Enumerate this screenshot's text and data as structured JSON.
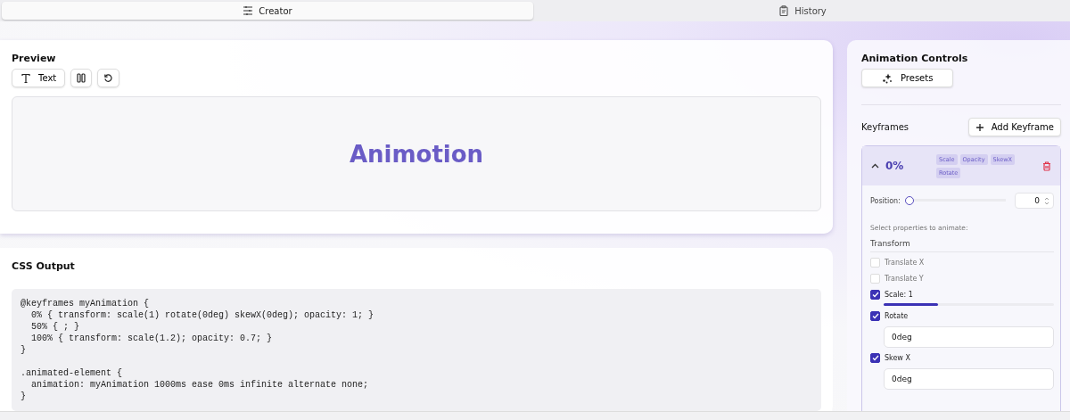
{
  "tabs": [
    {
      "label": "Creator",
      "selected": true
    },
    {
      "label": "History",
      "selected": false
    }
  ],
  "preview": {
    "title": "Preview",
    "text_button": "Text",
    "display_text": "Animotion"
  },
  "css_output": {
    "title": "CSS Output",
    "blocks": [
      [
        "@keyframes myAnimation {",
        "  0% { transform: scale(1) rotate(0deg) skewX(0deg); opacity: 1; }",
        "  50% { ; }",
        "  100% { transform: scale(1.2); opacity: 0.7; }",
        "}"
      ],
      [
        ".animated-element {",
        "  animation: myAnimation 1000ms ease 0ms infinite alternate none;",
        "}"
      ]
    ]
  },
  "controls": {
    "title": "Animation Controls",
    "presets_button": "Presets",
    "keyframes_label": "Keyframes",
    "add_button": "Add Keyframe",
    "keyframe": {
      "percent": "0%",
      "expanded": true,
      "tags": [
        "Scale",
        "Opacity",
        "SkewX",
        "Rotate"
      ],
      "position_label": "Position:",
      "position": {
        "level": 0
      },
      "position_value": "0",
      "hint": "Select properties to animate:",
      "group": "Transform",
      "properties": [
        {
          "kind": "plain",
          "label": "Translate X",
          "checked": false
        },
        {
          "kind": "plain",
          "label": "Translate Y",
          "checked": false
        },
        {
          "kind": "slider",
          "label": "Scale: 1",
          "checked": true,
          "level": 0.32
        },
        {
          "kind": "input",
          "label": "Rotate",
          "checked": true,
          "value": "0deg"
        },
        {
          "kind": "input",
          "label": "Skew X",
          "checked": true,
          "value": "0deg"
        }
      ]
    }
  }
}
